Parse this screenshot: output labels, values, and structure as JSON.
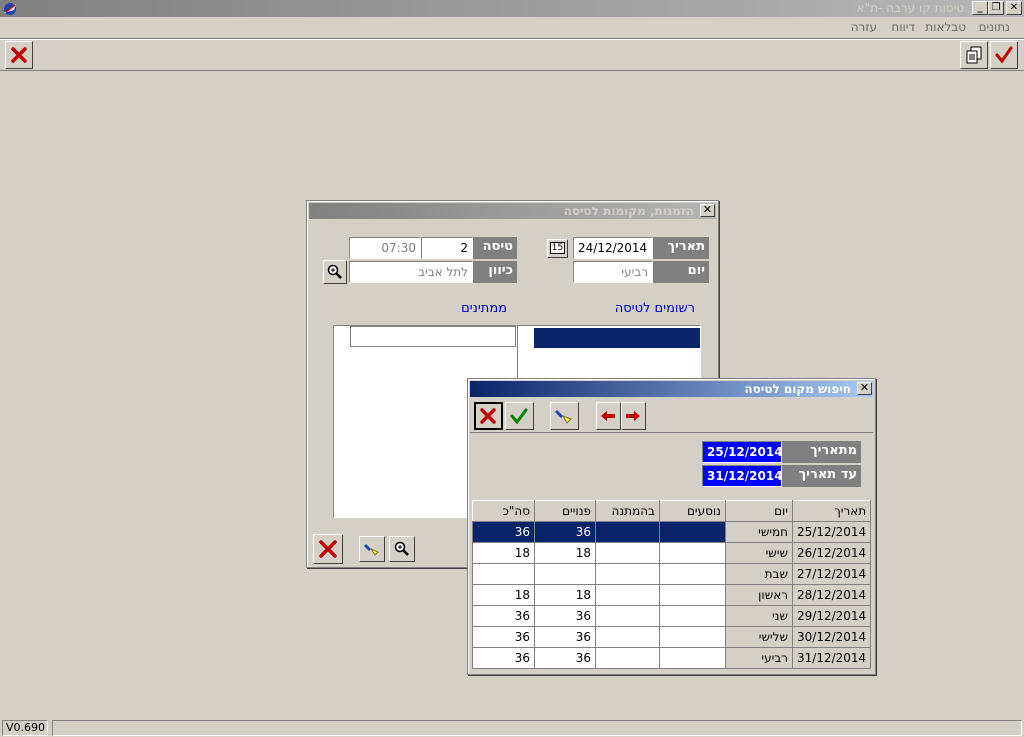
{
  "app": {
    "title": "טיסות קו ערבה -ת\"א",
    "version": "V0.690"
  },
  "menu": [
    "נתונים",
    "טבלאות",
    "דיווח",
    "עזרה"
  ],
  "window_buttons": {
    "minimize": "_",
    "restore": "❐",
    "close": "✕"
  },
  "reservation_dialog": {
    "title": "הזמנות, מקומות לטיסה",
    "date_label": "תאריך",
    "date_value": "24/12/2014",
    "calendar_btn": "15",
    "flight_label": "טיסה",
    "flight_number": "2",
    "flight_time": "07:30",
    "day_label": "יום",
    "day_value": "רביעי",
    "direction_label": "כיוון",
    "direction_value": "לתל אביב",
    "registered_label": "רשומים לטיסה",
    "waiting_label": "ממתינים"
  },
  "search_dialog": {
    "title": "חיפוש מקום לטיסה",
    "from_date_label": "מתאריך",
    "from_date_value": "25/12/2014",
    "to_date_label": "עד תאריך",
    "to_date_value": "31/12/2014",
    "columns": [
      "תאריך",
      "יום",
      "נוסעים",
      "בהמתנה",
      "פנויים",
      "סה\"כ"
    ],
    "rows": [
      {
        "date": "25/12/2014",
        "day": "חמישי",
        "passengers": "",
        "waiting": "",
        "free": "36",
        "total": "36"
      },
      {
        "date": "26/12/2014",
        "day": "שישי",
        "passengers": "",
        "waiting": "",
        "free": "18",
        "total": "18"
      },
      {
        "date": "27/12/2014",
        "day": "שבת",
        "passengers": "",
        "waiting": "",
        "free": "",
        "total": ""
      },
      {
        "date": "28/12/2014",
        "day": "ראשון",
        "passengers": "",
        "waiting": "",
        "free": "18",
        "total": "18"
      },
      {
        "date": "29/12/2014",
        "day": "שני",
        "passengers": "",
        "waiting": "",
        "free": "36",
        "total": "36"
      },
      {
        "date": "30/12/2014",
        "day": "שלישי",
        "passengers": "",
        "waiting": "",
        "free": "36",
        "total": "36"
      },
      {
        "date": "31/12/2014",
        "day": "רביעי",
        "passengers": "",
        "waiting": "",
        "free": "36",
        "total": "36"
      }
    ]
  },
  "colors": {
    "selection": "#0a246a",
    "date_field": "#0000ff",
    "link_text": "#0000cc"
  }
}
